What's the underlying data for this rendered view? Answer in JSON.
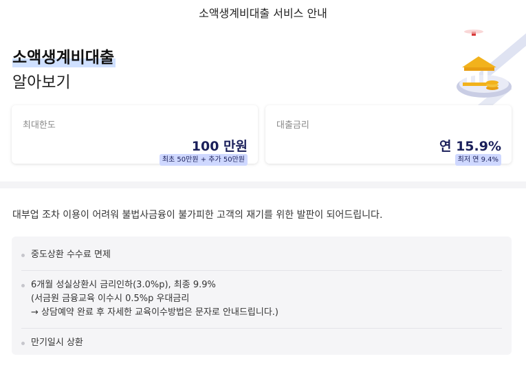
{
  "header": {
    "title": "소액생계비대출 서비스 안내"
  },
  "hero": {
    "title_line1": "소액생계비대출",
    "title_line2": "알아보기",
    "illustration_icon": "bank-building-coins-icon"
  },
  "cards": [
    {
      "label": "최대한도",
      "value": "100 만원",
      "badge": "최초 50만원 + 추가 50만원"
    },
    {
      "label": "대출금리",
      "value": "연 15.9%",
      "badge": "최저 연 9.4%"
    }
  ],
  "description": "대부업 조차 이용이 어려워 불법사금융이 불가피한 고객의 재기를 위한 발판이 되어드립니다.",
  "benefits": [
    {
      "lines": [
        "중도상환 수수료 면제"
      ]
    },
    {
      "lines": [
        "6개월 성실상환시 금리인하(3.0%p), 최종 9.9%",
        "(서금원 금융교육 이수시 0.5%p 우대금리",
        "→ 상담예약 완료 후 자세한 교육이수방법은 문자로 안내드립니다.)"
      ]
    },
    {
      "lines": [
        "만기일시 상환"
      ]
    }
  ],
  "colors": {
    "accent_navy": "#1a1f5a",
    "badge_bg": "#cfd8ff",
    "highlight": "#cfe0ff",
    "panel_bg": "#f5f5f7"
  }
}
